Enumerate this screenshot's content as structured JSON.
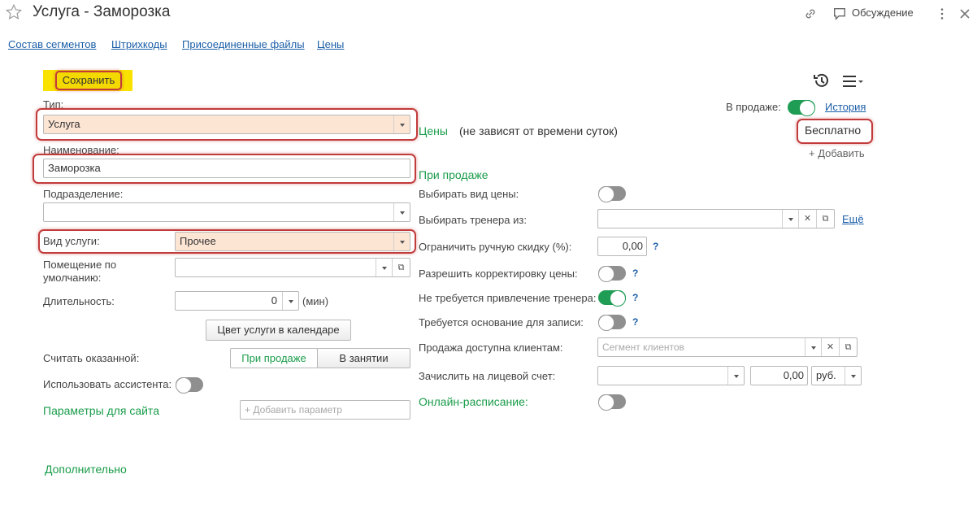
{
  "window": {
    "title": "Услуга - Заморозка",
    "discussion": "Обсуждение"
  },
  "nav": [
    "Состав сегментов",
    "Штрихкоды",
    "Присоединенные файлы",
    "Цены"
  ],
  "toolbar": {
    "save_label": "Сохранить"
  },
  "left": {
    "type_label": "Тип:",
    "type_value": "Услуга",
    "name_label": "Наименование:",
    "name_value": "Заморозка",
    "division_label": "Подразделение:",
    "division_value": "",
    "service_kind_label": "Вид услуги:",
    "service_kind_value": "Прочее",
    "room_label": "Помещение по умолчанию:",
    "room_value": "",
    "duration_label": "Длительность:",
    "duration_value": "0",
    "duration_unit": "(мин)",
    "calendar_color_button": "Цвет услуги в календаре",
    "count_as_rendered_label": "Считать оказанной:",
    "count_options": [
      "При продаже",
      "В занятии"
    ],
    "count_selected": "При продаже",
    "use_assistant_label": "Использовать ассистента:",
    "use_assistant": false,
    "site_params_label": "Параметры для сайта",
    "add_param_placeholder": "+ Добавить параметр",
    "additional_label": "Дополнительно"
  },
  "right": {
    "on_sale_label": "В продаже:",
    "on_sale": true,
    "history_link": "История",
    "prices_title": "Цены",
    "prices_note": "(не зависят от времени суток)",
    "price_value": "Бесплатно",
    "add_link": "+ Добавить",
    "on_sale_section": "При продаже",
    "choose_price_type_label": "Выбирать вид цены:",
    "choose_price_type": false,
    "choose_trainer_label": "Выбирать тренера из:",
    "choose_trainer_value": "",
    "more_link": "Ещё",
    "manual_discount_label": "Ограничить ручную скидку (%):",
    "manual_discount_value": "0,00",
    "allow_price_edit_label": "Разрешить корректировку цены:",
    "allow_price_edit": false,
    "no_trainer_label": "Не требуется привлечение тренера:",
    "no_trainer": true,
    "basis_required_label": "Требуется основание для записи:",
    "basis_required": false,
    "sale_available_label": "Продажа доступна клиентам:",
    "segment_placeholder": "Сегмент клиентов",
    "credit_account_label": "Зачислить на лицевой счет:",
    "credit_account_value": "",
    "credit_amount": "0,00",
    "currency": "руб.",
    "online_schedule_label": "Онлайн-расписание:",
    "online_schedule": false,
    "help_mark": "?"
  }
}
